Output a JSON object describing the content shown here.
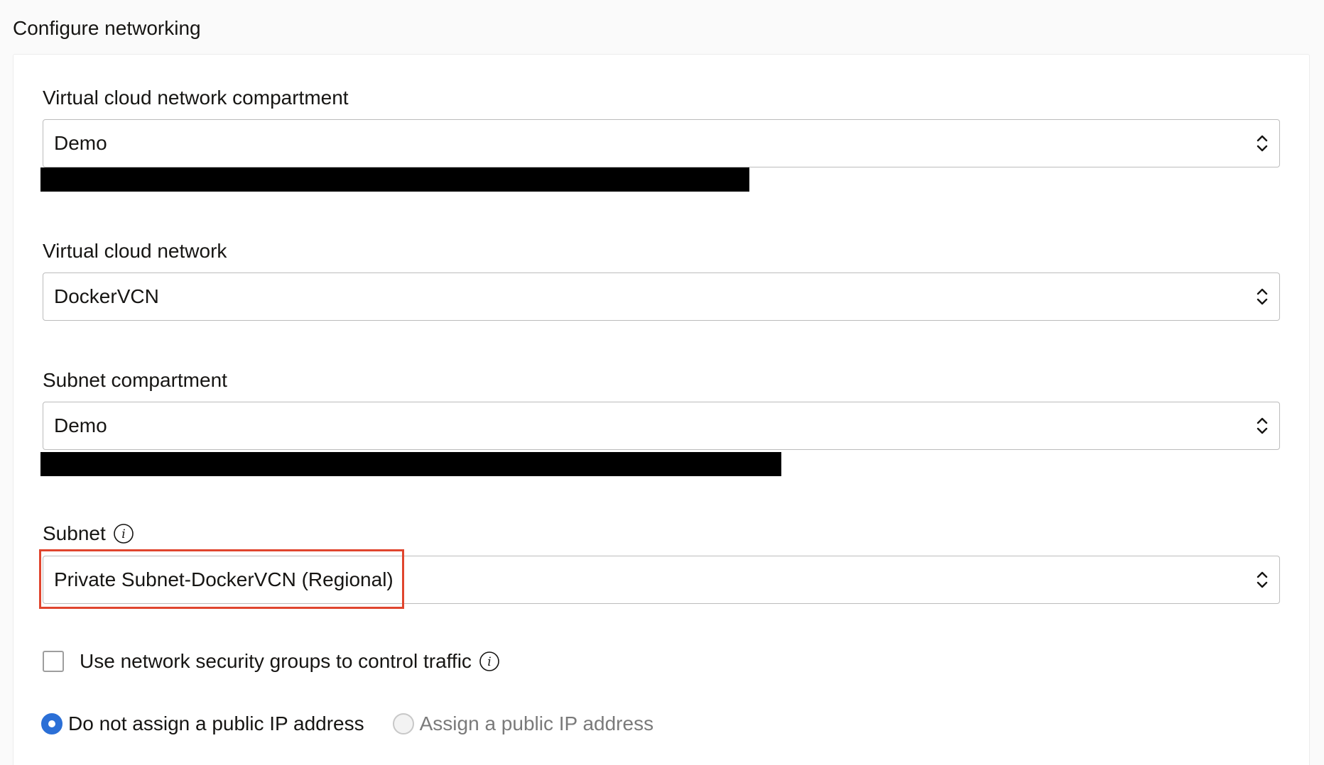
{
  "section": {
    "title": "Configure networking"
  },
  "fields": {
    "vcn_compartment": {
      "label": "Virtual cloud network compartment",
      "value": "Demo"
    },
    "vcn": {
      "label": "Virtual cloud network",
      "value": "DockerVCN"
    },
    "subnet_compartment": {
      "label": "Subnet compartment",
      "value": "Demo"
    },
    "subnet": {
      "label": "Subnet",
      "value": "Private Subnet-DockerVCN (Regional)"
    }
  },
  "nsg": {
    "label": "Use network security groups to control traffic",
    "checked": false
  },
  "public_ip": {
    "options": [
      {
        "label": "Do not assign a public IP address",
        "selected": true
      },
      {
        "label": "Assign a public IP address",
        "selected": false
      }
    ]
  },
  "colors": {
    "accent": "#2b6fd6",
    "highlight": "#e0452e",
    "redaction": "#000000"
  },
  "icons": {
    "select_chevron": "chevron-up-down-icon",
    "info": "info-icon"
  }
}
